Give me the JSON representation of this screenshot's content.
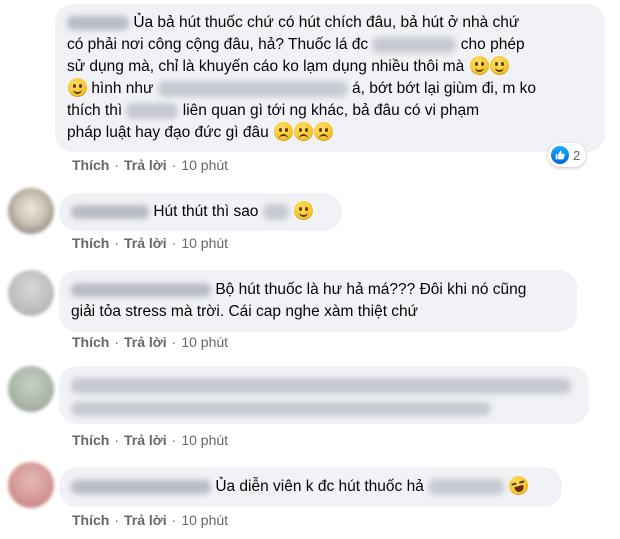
{
  "action_labels": {
    "like": "Thích",
    "reply": "Trả lời",
    "separator": "·"
  },
  "comments": [
    {
      "segments": {
        "s1": "Ủa bả hút thuốc chứ có hút chích đâu, bả hút ở nhà chứ",
        "s2": "có phải nơi công cộng đâu, hả? Thuốc lá đc",
        "s3": "cho phép",
        "s4": "sử dụng mà, chỉ là khuyến cáo ko lạm dụng nhiều thôi mà",
        "s5": "hình như",
        "s6": "á, bớt bớt lại giùm đi, m ko",
        "s7": "thích thì",
        "s8": "liên quan gì tới ng khác, bả đâu có vi phạm",
        "s9": "pháp luật hay đạo đức gì đâu"
      },
      "time": "10 phút",
      "reaction_count": "2",
      "reaction_icon": "like-icon"
    },
    {
      "text": "Hút thút thì sao",
      "time": "10 phút"
    },
    {
      "line1": "Bộ hút thuốc là hư hả má??? Đôi khi nó cũng",
      "line2": "giải tỏa stress mà trời. Cái cap nghe xàm thiệt chứ",
      "time": "10 phút"
    },
    {
      "time": "10 phút"
    },
    {
      "text": "Ủa diễn viên k đc hút thuốc hả",
      "time": "10 phút"
    }
  ],
  "colors": {
    "bubble": "#f0f2f5",
    "meta_text": "#65676b",
    "like_blue": "#1877f2"
  }
}
